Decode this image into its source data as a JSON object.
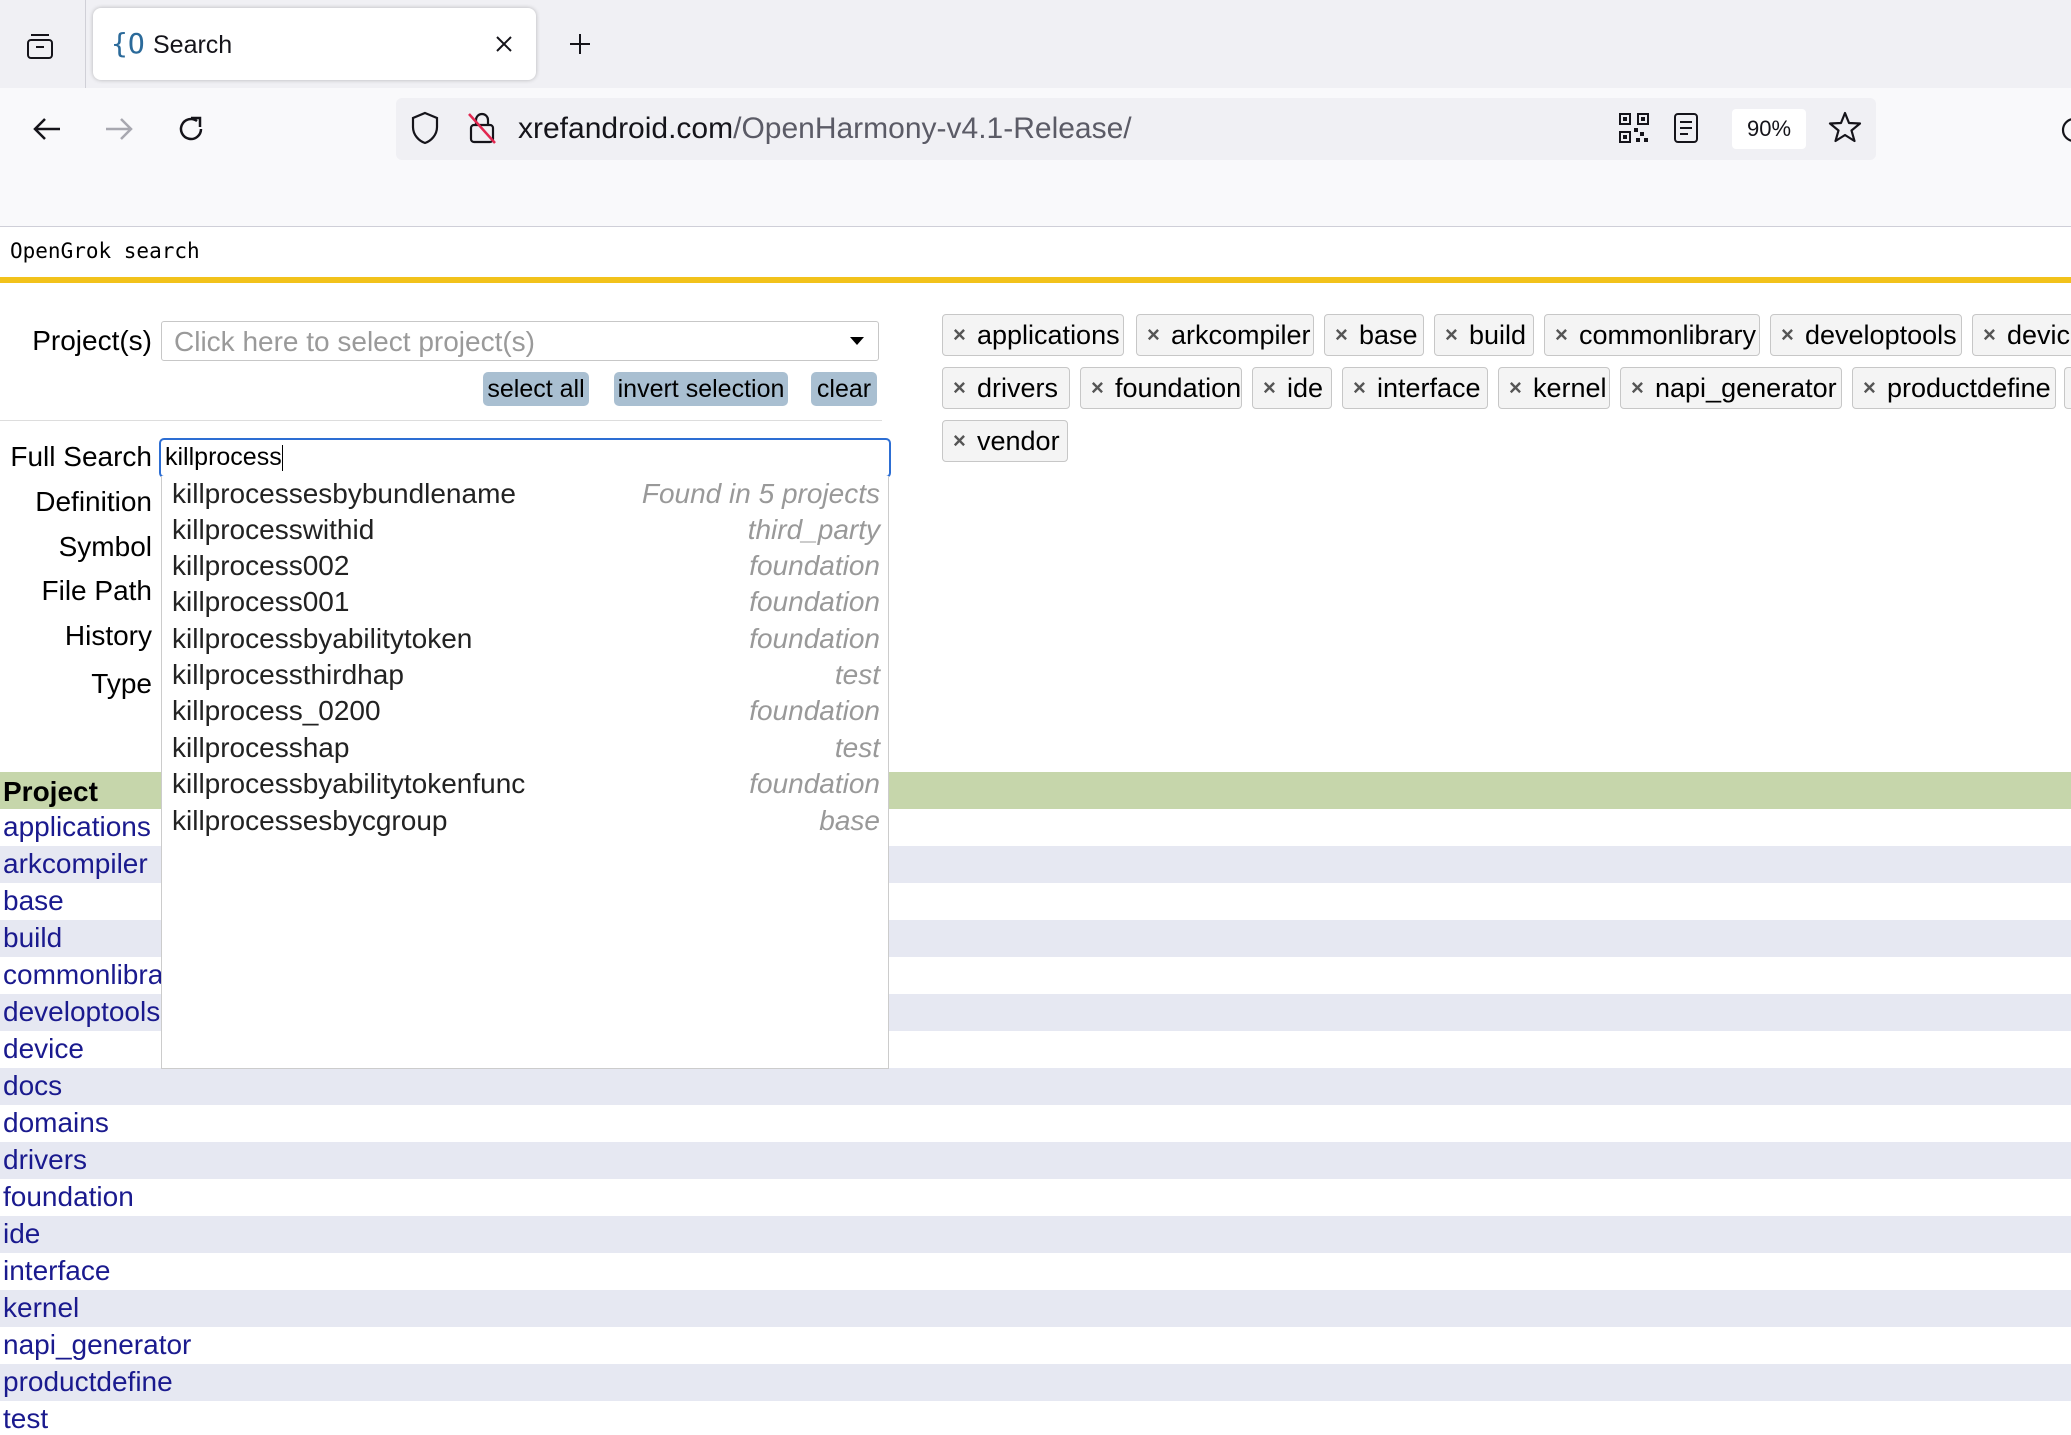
{
  "browser": {
    "tab_favicon": "{O",
    "tab_title": "Search",
    "url_host": "xrefandroid.com",
    "url_path": "/OpenHarmony-v4.1-Release/",
    "zoom": "90%"
  },
  "page": {
    "title": "OpenGrok search"
  },
  "form": {
    "projects_label": "Project(s)",
    "projects_placeholder": "Click here to select project(s)",
    "select_all": "select all",
    "invert_selection": "invert selection",
    "clear": "clear",
    "full_search_label": "Full Search",
    "full_search_value": "killprocess",
    "definition_label": "Definition",
    "symbol_label": "Symbol",
    "file_path_label": "File Path",
    "history_label": "History",
    "type_label": "Type"
  },
  "autocomplete": [
    {
      "name": "killprocessesbybundlename",
      "project": "Found in 5 projects"
    },
    {
      "name": "killprocesswithid",
      "project": "third_party"
    },
    {
      "name": "killprocess002",
      "project": "foundation"
    },
    {
      "name": "killprocess001",
      "project": "foundation"
    },
    {
      "name": "killprocessbyabilitytoken",
      "project": "foundation"
    },
    {
      "name": "killprocessthirdhap",
      "project": "test"
    },
    {
      "name": "killprocess_0200",
      "project": "foundation"
    },
    {
      "name": "killprocesshap",
      "project": "test"
    },
    {
      "name": "killprocessbyabilitytokenfunc",
      "project": "foundation"
    },
    {
      "name": "killprocessesbycgroup",
      "project": "base"
    }
  ],
  "chips": [
    {
      "x": "×",
      "label": "applications"
    },
    {
      "x": "×",
      "label": "arkcompiler"
    },
    {
      "x": "×",
      "label": "base"
    },
    {
      "x": "×",
      "label": "build"
    },
    {
      "x": "×",
      "label": "commonlibrary"
    },
    {
      "x": "×",
      "label": "developtools"
    },
    {
      "x": "×",
      "label": "device"
    },
    {
      "x": "×",
      "label": "drivers"
    },
    {
      "x": "×",
      "label": "foundation"
    },
    {
      "x": "×",
      "label": "ide"
    },
    {
      "x": "×",
      "label": "interface"
    },
    {
      "x": "×",
      "label": "kernel"
    },
    {
      "x": "×",
      "label": "napi_generator"
    },
    {
      "x": "×",
      "label": "productdefine"
    },
    {
      "x": "×",
      "label": "vendor"
    }
  ],
  "table": {
    "header": "Project",
    "rows": [
      "applications",
      "arkcompiler",
      "base",
      "build",
      "commonlibrary",
      "developtools",
      "device",
      "docs",
      "domains",
      "drivers",
      "foundation",
      "ide",
      "interface",
      "kernel",
      "napi_generator",
      "productdefine",
      "test"
    ]
  }
}
